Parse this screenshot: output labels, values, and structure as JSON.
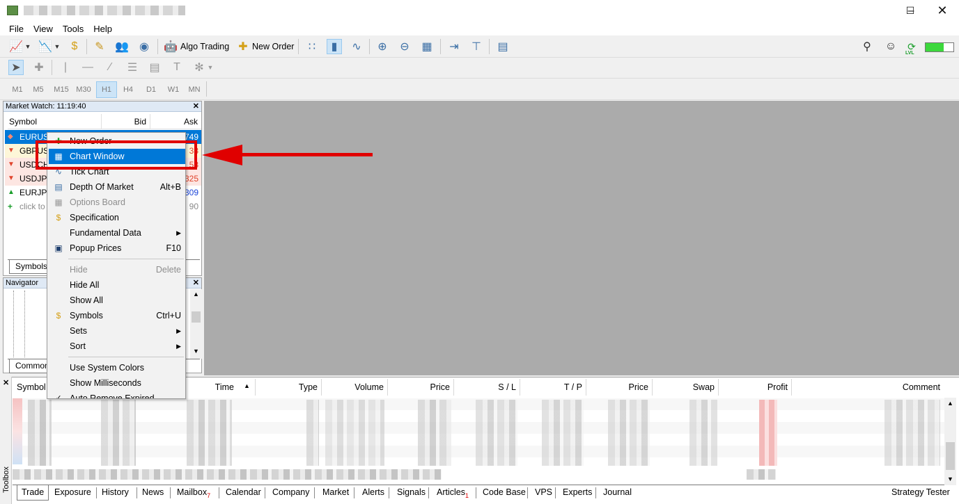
{
  "menubar": {
    "items": [
      "File",
      "View",
      "Tools",
      "Help"
    ]
  },
  "toolbar": {
    "algo_trading": "Algo Trading",
    "new_order": "New Order",
    "timeframes": [
      "M1",
      "M5",
      "M15",
      "M30",
      "H1",
      "H4",
      "D1",
      "W1",
      "MN"
    ],
    "active_timeframe": "H1",
    "lvl_label": "LVL"
  },
  "market_watch": {
    "title": "Market Watch: 11:19:40",
    "columns": [
      "Symbol",
      "Bid",
      "Ask"
    ],
    "rows": [
      {
        "symbol": "EURUSD",
        "ask": "749",
        "dir": "down"
      },
      {
        "symbol": "GBPUSD",
        "ask": "33",
        "dir": "down"
      },
      {
        "symbol": "USDCHF",
        "ask": "58",
        "dir": "down"
      },
      {
        "symbol": "USDJPY",
        "ask": "325",
        "dir": "down"
      },
      {
        "symbol": "EURJPY",
        "ask": "309",
        "dir": "up"
      }
    ],
    "add_row": "click to",
    "add_row_value": "90",
    "tab": "Symbols"
  },
  "navigator": {
    "title": "Navigator",
    "tab": "Common"
  },
  "context_menu": {
    "items": [
      {
        "label": "New Order",
        "icon": "new-order-icon",
        "shortcut": "",
        "disabled": false
      },
      {
        "label": "Chart Window",
        "icon": "chart-window-icon",
        "shortcut": "",
        "disabled": false,
        "highlighted": true
      },
      {
        "label": "Tick Chart",
        "icon": "tick-chart-icon",
        "shortcut": "",
        "disabled": false
      },
      {
        "label": "Depth Of Market",
        "icon": "depth-of-market-icon",
        "shortcut": "Alt+B",
        "disabled": false
      },
      {
        "label": "Options Board",
        "icon": "options-board-icon",
        "shortcut": "",
        "disabled": true
      },
      {
        "label": "Specification",
        "icon": "specification-icon",
        "shortcut": "",
        "disabled": false
      },
      {
        "label": "Fundamental Data",
        "icon": "",
        "shortcut": "",
        "submenu": true
      },
      {
        "label": "Popup Prices",
        "icon": "popup-prices-icon",
        "shortcut": "F10"
      },
      {
        "label": "Hide",
        "icon": "",
        "shortcut": "Delete",
        "disabled": true
      },
      {
        "label": "Hide All",
        "icon": "",
        "shortcut": ""
      },
      {
        "label": "Show All",
        "icon": "",
        "shortcut": ""
      },
      {
        "label": "Symbols",
        "icon": "symbols-icon",
        "shortcut": "Ctrl+U"
      },
      {
        "label": "Sets",
        "icon": "",
        "submenu": true
      },
      {
        "label": "Sort",
        "icon": "",
        "submenu": true
      },
      {
        "label": "Use System Colors",
        "icon": ""
      },
      {
        "label": "Show Milliseconds",
        "icon": ""
      },
      {
        "label": "Auto Remove Expired",
        "icon": "check-icon",
        "checked": true
      }
    ]
  },
  "toolbox": {
    "label": "Toolbox",
    "columns": [
      "Symbol",
      "Time",
      "Type",
      "Volume",
      "Price",
      "S / L",
      "T / P",
      "Price",
      "Swap",
      "Profit",
      "Comment"
    ],
    "tabs": [
      "Trade",
      "Exposure",
      "History",
      "News",
      "Mailbox",
      "Calendar",
      "Company",
      "Market",
      "Alerts",
      "Signals",
      "Articles",
      "Code Base",
      "VPS",
      "Experts",
      "Journal"
    ],
    "mailbox_badge": "7",
    "articles_badge": "1",
    "strategy_tester": "Strategy Tester"
  },
  "colors": {
    "accent": "#0078d7",
    "annotation": "#e00000",
    "down": "#e0442c",
    "up": "#1a9e2b"
  }
}
